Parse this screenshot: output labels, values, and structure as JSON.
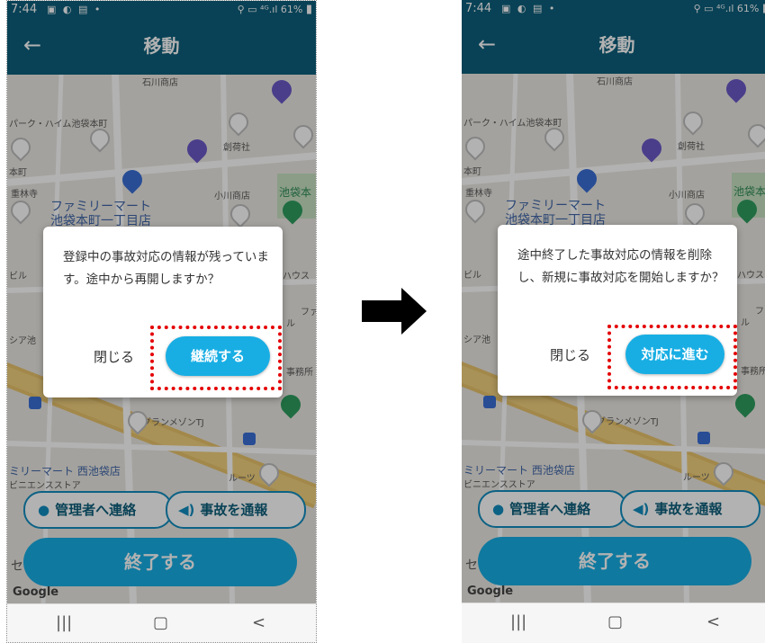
{
  "status": {
    "time": "7:44",
    "battery": "61%"
  },
  "appbar": {
    "title": "移動",
    "back_icon": "arrow-left-icon"
  },
  "map": {
    "labels": [
      "パーク・ハイム池袋本町",
      "創荷社",
      "小川商店",
      "ファミリーマート",
      "池袋本町一丁目店",
      "グランメゾンTJ",
      "ミリーマート 西池袋店",
      "ビニエンスストア",
      "ルーツ",
      "池袋本",
      "石川商店",
      "本町",
      "重林寺",
      "ビル",
      "ハウス",
      "シア池",
      "ファ",
      "ル",
      "事務所",
      "セ"
    ]
  },
  "left_dialog": {
    "message": "登録中の事故対応の情報が残っています。途中から再開しますか？",
    "close_label": "閉じる",
    "primary_label": "継続する"
  },
  "right_dialog": {
    "message": "途中終了した事故対応の情報を削除し、新規に事故対応を開始しますか？",
    "close_label": "閉じる",
    "primary_label": "対応に進む"
  },
  "actions": {
    "contact_label": "管理者へ連絡",
    "report_label": "事故を通報",
    "end_label": "終了する"
  },
  "google": "Google",
  "navbar": {
    "recents": "|||",
    "home": "▢",
    "back": "<"
  },
  "colors": {
    "appbar": "#0e5f7c",
    "primary": "#18aee4",
    "highlight": "#e40000"
  }
}
